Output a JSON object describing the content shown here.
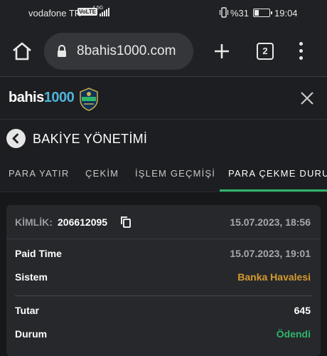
{
  "status_bar": {
    "carrier": "vodafone TR",
    "volte": "VoLTE",
    "network": "4.5G",
    "battery": "%31",
    "battery_level": 0.31,
    "time": "19:04"
  },
  "browser": {
    "url": "8bahis1000.com",
    "tab_count": "2",
    "icons": [
      "home-icon",
      "lock-icon",
      "new-tab-icon",
      "tab-switcher-icon",
      "menu-icon"
    ]
  },
  "site": {
    "logo_text_a": "bahis",
    "logo_text_b": "1000",
    "close_icon": "close-icon"
  },
  "page": {
    "title": "BAKİYE YÖNETİMİ"
  },
  "tabs": [
    {
      "label": "PARA YATIR"
    },
    {
      "label": "ÇEKİM"
    },
    {
      "label": "İŞLEM GEÇMİŞİ"
    },
    {
      "label": "PARA ÇEKME DURUMU",
      "active": true
    }
  ],
  "withdrawal": {
    "id_label": "KİMLİK:",
    "id_value": "206612095",
    "created": "15.07.2023, 18:56",
    "rows_1": [
      {
        "label": "Paid Time",
        "value": "15.07.2023, 19:01",
        "color": "#a6a7ab"
      },
      {
        "label": "Sistem",
        "value": "Banka Havalesi",
        "color": "#d49b2c"
      }
    ],
    "rows_2": [
      {
        "label": "Tutar",
        "value": "645",
        "color": "#ffffff"
      },
      {
        "label": "Durum",
        "value": "Ödendi",
        "color": "#2fb56a"
      }
    ]
  },
  "colors": {
    "accent_green": "#2fb56a",
    "system_orange": "#d49b2c",
    "background": "#1b1c1e",
    "card": "#27282c"
  }
}
